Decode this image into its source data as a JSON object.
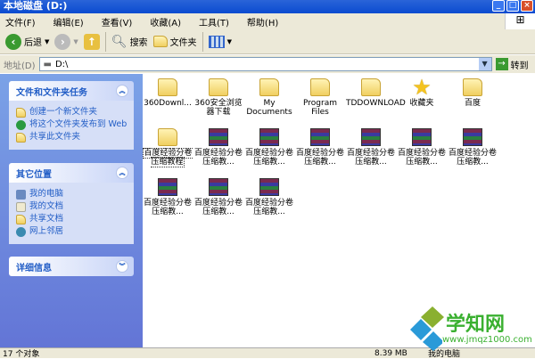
{
  "window": {
    "title": "本地磁盘 (D:)"
  },
  "menu": [
    "文件(F)",
    "编辑(E)",
    "查看(V)",
    "收藏(A)",
    "工具(T)",
    "帮助(H)"
  ],
  "toolbar": {
    "back": "后退",
    "search": "搜索",
    "folders": "文件夹"
  },
  "address": {
    "label": "地址(D)",
    "value": "D:\\",
    "go": "转到"
  },
  "sidebar": {
    "tasks": {
      "title": "文件和文件夹任务",
      "items": [
        "创建一个新文件夹",
        "将这个文件夹发布到 Web",
        "共享此文件夹"
      ]
    },
    "places": {
      "title": "其它位置",
      "items": [
        "我的电脑",
        "我的文档",
        "共享文档",
        "网上邻居"
      ]
    },
    "details": {
      "title": "详细信息"
    }
  },
  "files": [
    {
      "name": "360Downl...",
      "type": "folder"
    },
    {
      "name": "360安全浏览器下载",
      "type": "folder"
    },
    {
      "name": "My Documents",
      "type": "folder"
    },
    {
      "name": "Program Files",
      "type": "folder"
    },
    {
      "name": "TDDOWNLOAD",
      "type": "folder"
    },
    {
      "name": "收藏夹",
      "type": "favorites"
    },
    {
      "name": "百度",
      "type": "folder"
    },
    {
      "name": "百度经验分卷压缩教程",
      "type": "folder",
      "selected": true
    },
    {
      "name": "百度经验分卷压缩教...",
      "type": "rar"
    },
    {
      "name": "百度经验分卷压缩教...",
      "type": "rar"
    },
    {
      "name": "百度经验分卷压缩教...",
      "type": "rar"
    },
    {
      "name": "百度经验分卷压缩教...",
      "type": "rar"
    },
    {
      "name": "百度经验分卷压缩教...",
      "type": "rar"
    },
    {
      "name": "百度经验分卷压缩教...",
      "type": "rar"
    },
    {
      "name": "百度经验分卷压缩教...",
      "type": "rar"
    },
    {
      "name": "百度经验分卷压缩教...",
      "type": "rar"
    },
    {
      "name": "百度经验分卷压缩教...",
      "type": "rar"
    }
  ],
  "status": {
    "count": "17 个对象",
    "size": "8.39 MB",
    "location": "我的电脑"
  },
  "watermark": {
    "name": "学知网",
    "url": "www.jmqz1000.com"
  }
}
